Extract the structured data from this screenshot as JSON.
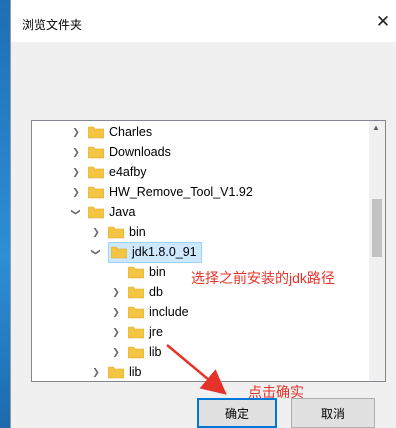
{
  "dialog": {
    "title": "浏览文件夹",
    "close_glyph": "✕",
    "ok_label": "确定",
    "cancel_label": "取消"
  },
  "tree": {
    "items": [
      {
        "label": "Charles",
        "expanded": false
      },
      {
        "label": "Downloads",
        "expanded": false
      },
      {
        "label": "e4afby",
        "expanded": false
      },
      {
        "label": "HW_Remove_Tool_V1.92",
        "expanded": false
      },
      {
        "label": "Java",
        "expanded": true
      },
      {
        "label": "bin",
        "expanded": false
      },
      {
        "label": "jdk1.8.0_91",
        "expanded": true,
        "selected": true
      },
      {
        "label": "bin",
        "expanded": false
      },
      {
        "label": "db",
        "expanded": false
      },
      {
        "label": "include",
        "expanded": false
      },
      {
        "label": "jre",
        "expanded": false
      },
      {
        "label": "lib",
        "expanded": false
      },
      {
        "label": "lib",
        "expanded": false
      }
    ]
  },
  "annotations": {
    "select_jdk": "选择之前安装的jdk路径",
    "click_ok": "点击确实"
  },
  "colors": {
    "annotation": "#e5332a",
    "selection_bg": "#cde8ff",
    "folder": "#f4c542",
    "accent": "#0078d7"
  }
}
